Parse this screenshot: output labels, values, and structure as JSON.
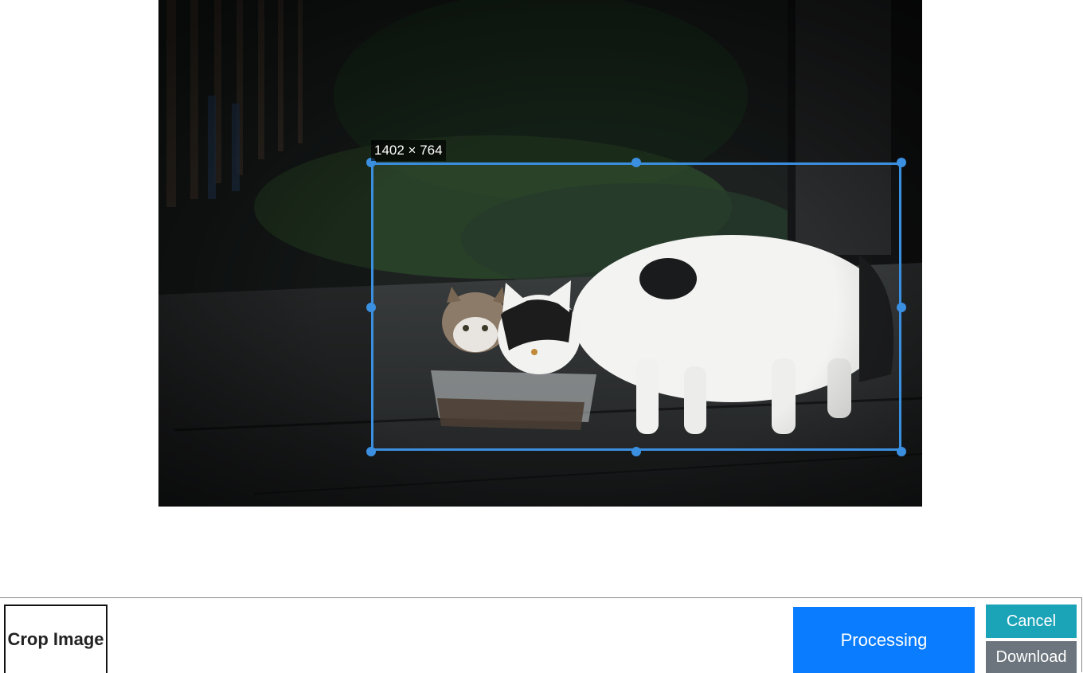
{
  "cropper": {
    "size_label": "1402 × 764"
  },
  "toolbar": {
    "title": "Crop Image",
    "processing_label": "Processing",
    "cancel_label": "Cancel",
    "download_label": "Download"
  },
  "colors": {
    "crop_border": "#3b8fe0",
    "processing_bg": "#0a7cff",
    "cancel_bg": "#1ba3b8",
    "download_bg": "#6c757d"
  },
  "icons": {
    "image": "photo-of-cats"
  }
}
